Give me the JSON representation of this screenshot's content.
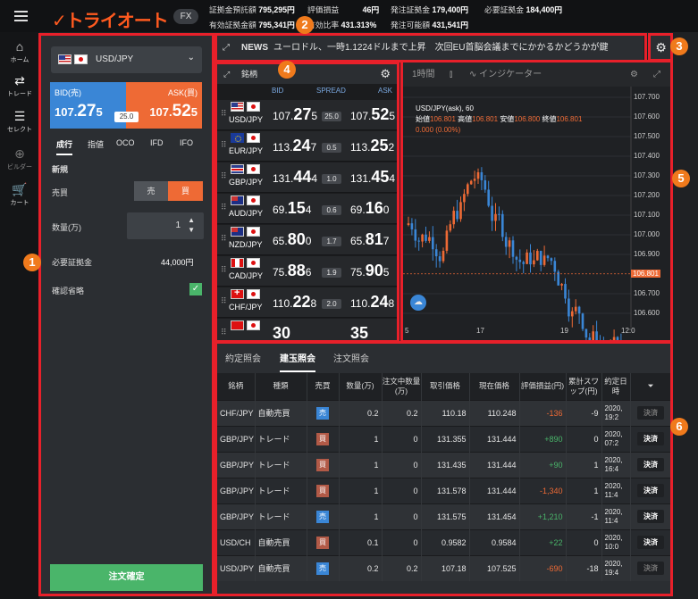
{
  "header": {
    "logo": "トライオート",
    "product": "FX",
    "stats": [
      {
        "label": "証拠金預託額",
        "value": "795,295円"
      },
      {
        "label": "評価損益",
        "value": "46円"
      },
      {
        "label": "発注証拠金",
        "value": "179,400円"
      },
      {
        "label": "必要証拠金",
        "value": "184,400円"
      },
      {
        "label": "有効証拠金額",
        "value": "795,341円"
      },
      {
        "label": "有効比率",
        "value": "431.313%"
      },
      {
        "label": "発注可能額",
        "value": "431,541円"
      }
    ]
  },
  "nav": [
    {
      "label": "ホーム",
      "icon": "home-icon"
    },
    {
      "label": "トレード",
      "icon": "trade-icon"
    },
    {
      "label": "セレクト",
      "icon": "select-icon"
    },
    {
      "label": "ビルダー",
      "icon": "builder-icon"
    },
    {
      "label": "カート",
      "icon": "cart-icon"
    }
  ],
  "order": {
    "pair": "USD/JPY",
    "bid_label": "BID(売)",
    "ask_label": "ASK(買)",
    "bid_int": "107.",
    "bid_big": "27",
    "bid_small": "5",
    "ask_int": "107.",
    "ask_big": "52",
    "ask_small": "5",
    "spread": "25.0",
    "tabs": [
      "成行",
      "指値",
      "OCO",
      "IFD",
      "IFO"
    ],
    "section": "新規",
    "side_label": "売買",
    "sell": "売",
    "buy": "買",
    "qty_label": "数量(万)",
    "qty": "1",
    "margin_label": "必要証拠金",
    "margin": "44,000円",
    "skip_confirm": "確認省略",
    "confirm_button": "注文確定"
  },
  "news": {
    "label": "NEWS",
    "text": "ユーロドル、一時1.1224ドルまで上昇　次回EU首脳会議までにかかるかどうかが鍵"
  },
  "ratelist": {
    "title": "銘柄",
    "col_bid": "BID",
    "col_spread": "SPREAD",
    "col_ask": "ASK",
    "rows": [
      {
        "f1": "us",
        "f2": "jp",
        "sym": "USD/JPY",
        "bi": "107.",
        "bb": "27",
        "bs": "5",
        "sp": "25.0",
        "ai": "107.",
        "ab": "52",
        "as": "5"
      },
      {
        "f1": "eu",
        "f2": "jp",
        "sym": "EUR/JPY",
        "bi": "113.",
        "bb": "24",
        "bs": "7",
        "sp": "0.5",
        "ai": "113.",
        "ab": "25",
        "as": "2"
      },
      {
        "f1": "gb",
        "f2": "jp",
        "sym": "GBP/JPY",
        "bi": "131.",
        "bb": "44",
        "bs": "4",
        "sp": "1.0",
        "ai": "131.",
        "ab": "45",
        "as": "4"
      },
      {
        "f1": "au",
        "f2": "jp",
        "sym": "AUD/JPY",
        "bi": "69.",
        "bb": "15",
        "bs": "4",
        "sp": "0.6",
        "ai": "69.",
        "ab": "16",
        "as": "0"
      },
      {
        "f1": "au",
        "f2": "jp",
        "sym": "NZD/JPY",
        "bi": "65.",
        "bb": "80",
        "bs": "0",
        "sp": "1.7",
        "ai": "65.",
        "ab": "81",
        "as": "7"
      },
      {
        "f1": "ca",
        "f2": "jp",
        "sym": "CAD/JPY",
        "bi": "75.",
        "bb": "88",
        "bs": "6",
        "sp": "1.9",
        "ai": "75.",
        "ab": "90",
        "as": "5"
      },
      {
        "f1": "ch",
        "f2": "jp",
        "sym": "CHF/JPY",
        "bi": "110.",
        "bb": "22",
        "bs": "8",
        "sp": "2.0",
        "ai": "110.",
        "ab": "24",
        "as": "8"
      },
      {
        "f1": "tr",
        "f2": "jp",
        "sym": "",
        "bi": "",
        "bb": "30",
        "bs": "",
        "sp": "",
        "ai": "",
        "ab": "35",
        "as": ""
      }
    ]
  },
  "chart": {
    "interval": "1時間",
    "indicator": "インジケーター",
    "title": "USD/JPY(ask), 60",
    "ohlc": {
      "open_label": "始値",
      "open": "106.801",
      "high_label": "高値",
      "high": "106.801",
      "low_label": "安値",
      "low": "106.800",
      "close_label": "終値",
      "close": "106.801"
    },
    "change": "0.000 (0.00%)",
    "last": "106.801",
    "yticks": [
      "107.700",
      "107.600",
      "107.500",
      "107.400",
      "107.300",
      "107.200",
      "107.100",
      "107.000",
      "106.900",
      "106.801",
      "106.700",
      "106.600"
    ],
    "xticks": [
      "5",
      "17",
      "19",
      "12:0"
    ],
    "colors": {
      "up": "#ee6a35",
      "down": "#3a86d6"
    }
  },
  "positions": {
    "tabs": [
      "約定照会",
      "建玉照会",
      "注文照会"
    ],
    "headers": [
      "銘柄",
      "種類",
      "売買",
      "数量(万)",
      "注文中数量(万)",
      "取引価格",
      "現在価格",
      "評価損益(円)",
      "累計スワップ(円)",
      "約定日時"
    ],
    "settle": "決済",
    "rows": [
      {
        "sym": "CHF/JPY",
        "type": "自動売買",
        "side": "売",
        "qty": "0.2",
        "pend": "0.2",
        "price": "110.18",
        "cur": "110.248",
        "pl": "-136",
        "swap": "-9",
        "d1": "2020,",
        "d2": "19:2"
      },
      {
        "sym": "GBP/JPY",
        "type": "トレード",
        "side": "買",
        "qty": "1",
        "pend": "0",
        "price": "131.355",
        "cur": "131.444",
        "pl": "+890",
        "swap": "0",
        "d1": "2020,",
        "d2": "07:2"
      },
      {
        "sym": "GBP/JPY",
        "type": "トレード",
        "side": "買",
        "qty": "1",
        "pend": "0",
        "price": "131.435",
        "cur": "131.444",
        "pl": "+90",
        "swap": "1",
        "d1": "2020,",
        "d2": "16:4"
      },
      {
        "sym": "GBP/JPY",
        "type": "トレード",
        "side": "買",
        "qty": "1",
        "pend": "0",
        "price": "131.578",
        "cur": "131.444",
        "pl": "-1,340",
        "swap": "1",
        "d1": "2020,",
        "d2": "11:4"
      },
      {
        "sym": "GBP/JPY",
        "type": "トレード",
        "side": "売",
        "qty": "1",
        "pend": "0",
        "price": "131.575",
        "cur": "131.454",
        "pl": "+1,210",
        "swap": "-1",
        "d1": "2020,",
        "d2": "11:4"
      },
      {
        "sym": "USD/CH",
        "type": "自動売買",
        "side": "買",
        "qty": "0.1",
        "pend": "0",
        "price": "0.9582",
        "cur": "0.9584",
        "pl": "+22",
        "swap": "0",
        "d1": "2020,",
        "d2": "10:0"
      },
      {
        "sym": "USD/JPY",
        "type": "自動売買",
        "side": "売",
        "qty": "0.2",
        "pend": "0.2",
        "price": "107.18",
        "cur": "107.525",
        "pl": "-690",
        "swap": "-18",
        "d1": "2020,",
        "d2": "19:4"
      }
    ]
  },
  "markers": [
    "1",
    "2",
    "3",
    "4",
    "5",
    "6"
  ]
}
